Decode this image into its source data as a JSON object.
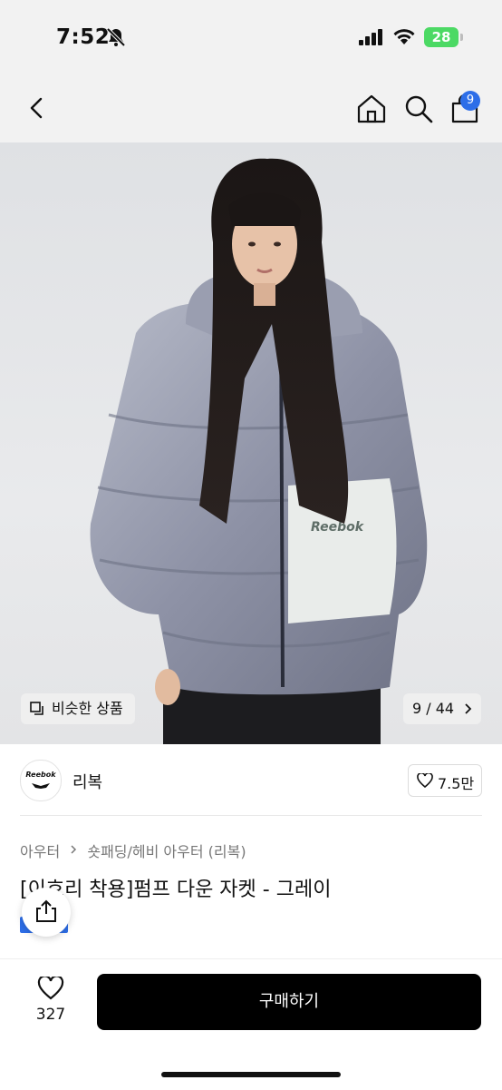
{
  "status_bar": {
    "time": "7:52",
    "battery": "28"
  },
  "nav": {
    "cart_count": "9"
  },
  "product_image": {
    "similar_label": "비슷한 상품",
    "counter": "9 / 44",
    "jacket_logo": "Reebok"
  },
  "brand": {
    "logo_text": "Reebok",
    "name": "리복",
    "likes": "7.5만"
  },
  "breadcrumb": {
    "items": [
      "아우터",
      "숏패딩/헤비 아우터 (리복)"
    ]
  },
  "product": {
    "title": "[이효리 착용]펌프 다운 자켓 - 그레이"
  },
  "bottom_bar": {
    "wish_count": "327",
    "buy_label": "구매하기"
  },
  "colors": {
    "accent": "#2d6ee8",
    "buy_button": "#000000",
    "battery": "#4cd964"
  },
  "icons": [
    "bell-slash-icon",
    "signal-icon",
    "wifi-icon",
    "back-icon",
    "home-icon",
    "search-icon",
    "cart-icon",
    "similar-icon",
    "chevron-right-icon",
    "heart-icon",
    "share-icon"
  ]
}
